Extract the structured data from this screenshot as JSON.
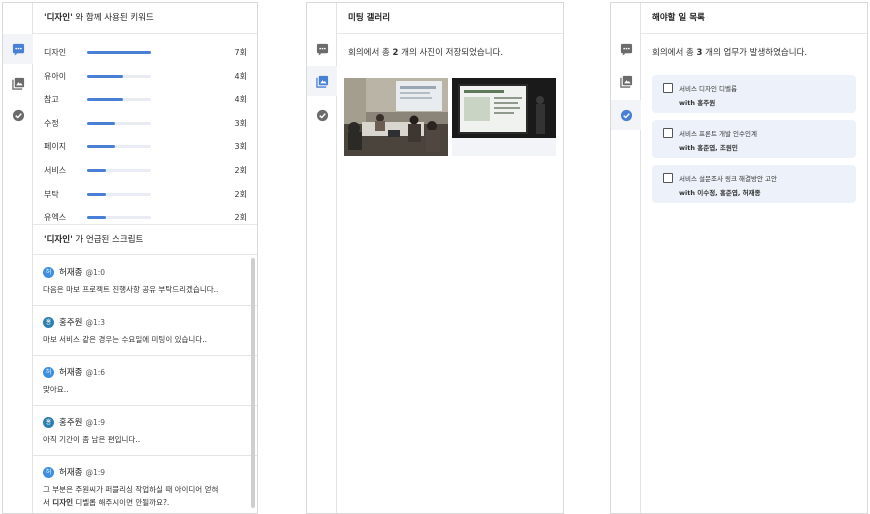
{
  "keywords_panel": {
    "header_quote": "'디자인'",
    "header_rest": " 와 함께 사용된 키워드",
    "keywords": [
      {
        "label": "디자인",
        "count": "7회",
        "ratio": 1.0
      },
      {
        "label": "유아이",
        "count": "4회",
        "ratio": 0.57
      },
      {
        "label": "참고",
        "count": "4회",
        "ratio": 0.57
      },
      {
        "label": "수정",
        "count": "3회",
        "ratio": 0.43
      },
      {
        "label": "페이지",
        "count": "3회",
        "ratio": 0.43
      },
      {
        "label": "서비스",
        "count": "2회",
        "ratio": 0.29
      },
      {
        "label": "부탁",
        "count": "2회",
        "ratio": 0.29
      },
      {
        "label": "유엑스",
        "count": "2회",
        "ratio": 0.29
      }
    ],
    "scripts_header_quote": "'디자인'",
    "scripts_header_rest": " 가 언급된 스크립트",
    "scripts": [
      {
        "avatar": "허",
        "speaker": "허재종",
        "time": "@1:0",
        "text": "다음은 마보 프로젝트 진행사항 공유 부탁드리겠습니다.."
      },
      {
        "avatar": "홍",
        "speaker": "홍주원",
        "time": "@1:3",
        "text": "마보 서비스 같은 경우는 수요일에 미팅이 있습니다.."
      },
      {
        "avatar": "허",
        "speaker": "허재종",
        "time": "@1:6",
        "text": "맞아요.."
      },
      {
        "avatar": "홍",
        "speaker": "홍주원",
        "time": "@1:9",
        "text": "아직 기간이 좀 남은 편입니다.."
      },
      {
        "avatar": "허",
        "speaker": "허재종",
        "time": "@1:9",
        "text_line1": "그 부분은 주원씨가 퍼블리싱 작업하실 때 아이디어 얻혀",
        "text_line2_pre": "서 ",
        "text_line2_bold": "디자인",
        "text_line2_post": " 디벨롭 해주시이면 안될까요?."
      }
    ]
  },
  "gallery_panel": {
    "header": "미팅 갤러리",
    "desc_pre": "회의에서 총 ",
    "desc_num": "2",
    "desc_post": " 개의 사진이 저장되었습니다."
  },
  "tasks_panel": {
    "header": "해야할 일 목록",
    "desc_pre": "회의에서 총 ",
    "desc_num": "3",
    "desc_post": " 개의 업무가 발생하였습니다.",
    "tasks": [
      {
        "title": "서비스 디자인 디벨롭",
        "with": "with 홍주원"
      },
      {
        "title": "서비스 프론트 개발 인수인계",
        "with": "with 홍준엽, 조원민"
      },
      {
        "title": "서비스 설문조사 링크 해결방안 고안",
        "with": "with 이수정, 홍준엽, 허재종"
      }
    ]
  },
  "colors": {
    "accent": "#4a7fd6",
    "rail_icon": "#6b6b6b",
    "task_bg": "#edf2fa"
  }
}
